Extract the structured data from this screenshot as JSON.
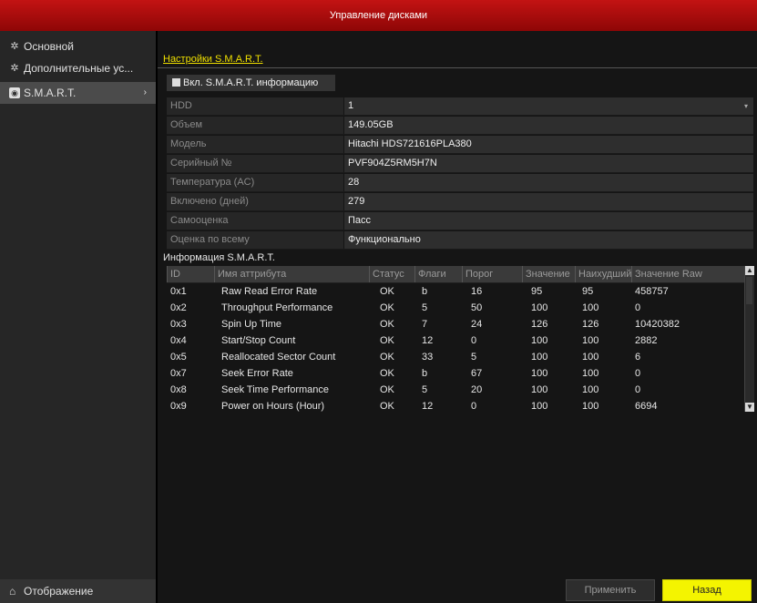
{
  "title": "Управление дисками",
  "sidebar": {
    "items": [
      {
        "label": "Основной",
        "icon": "gear-icon"
      },
      {
        "label": "Дополнительные ус...",
        "icon": "gears-icon"
      },
      {
        "label": "S.M.A.R.T.",
        "icon": "smart-icon",
        "arrow": "›"
      }
    ],
    "bottom": {
      "label": "Отображение",
      "icon": "home-icon"
    }
  },
  "main": {
    "section_link": "Настройки S.M.A.R.T.",
    "checkbox_label": "Вкл. S.M.A.R.T. информацию",
    "props": [
      {
        "key": "HDD",
        "value": "1",
        "dropdown": true
      },
      {
        "key": "Объем",
        "value": "149.05GB"
      },
      {
        "key": "Модель",
        "value": "Hitachi HDS721616PLA380"
      },
      {
        "key": "Серийный №",
        "value": "PVF904Z5RM5H7N"
      },
      {
        "key": "Температура (AC)",
        "value": "28"
      },
      {
        "key": "Включено (дней)",
        "value": "279"
      },
      {
        "key": "Самооценка",
        "value": "Пасс"
      },
      {
        "key": "Оценка по всему",
        "value": "Функционально"
      }
    ],
    "smart_title": "Информация S.M.A.R.T.",
    "table": {
      "headers": [
        "ID",
        "Имя аттрибута",
        "Статус",
        "Флаги",
        "Порог",
        "Значение",
        "Наихудший",
        "Значение Raw"
      ],
      "rows": [
        [
          "0x1",
          "Raw Read Error Rate",
          "OK",
          "b",
          "16",
          "95",
          "95",
          "458757"
        ],
        [
          "0x2",
          "Throughput Performance",
          "OK",
          "5",
          "50",
          "100",
          "100",
          "0"
        ],
        [
          "0x3",
          "Spin Up Time",
          "OK",
          "7",
          "24",
          "126",
          "126",
          "10420382"
        ],
        [
          "0x4",
          "Start/Stop Count",
          "OK",
          "12",
          "0",
          "100",
          "100",
          "2882"
        ],
        [
          "0x5",
          "Reallocated Sector Count",
          "OK",
          "33",
          "5",
          "100",
          "100",
          "6"
        ],
        [
          "0x7",
          "Seek Error Rate",
          "OK",
          "b",
          "67",
          "100",
          "100",
          "0"
        ],
        [
          "0x8",
          "Seek Time Performance",
          "OK",
          "5",
          "20",
          "100",
          "100",
          "0"
        ],
        [
          "0x9",
          "Power on Hours (Hour)",
          "OK",
          "12",
          "0",
          "100",
          "100",
          "6694"
        ]
      ]
    }
  },
  "buttons": {
    "apply": "Применить",
    "back": "Назад"
  }
}
